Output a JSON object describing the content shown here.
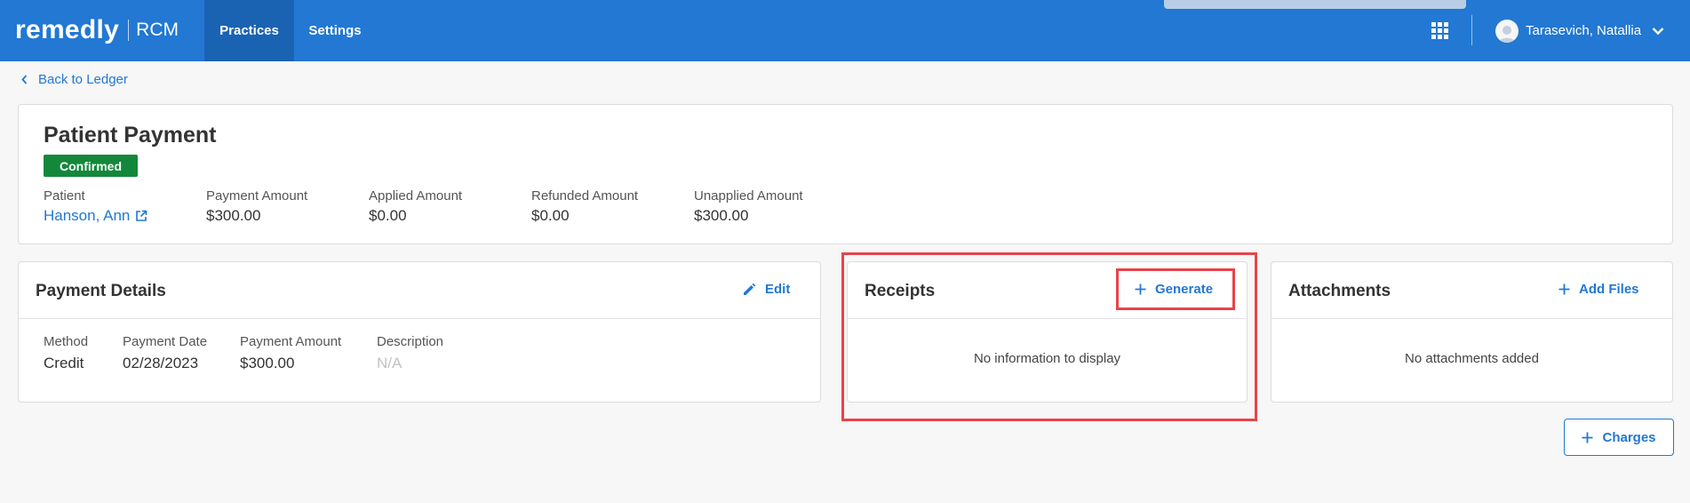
{
  "header": {
    "logo_main": "remedly",
    "logo_sub": "RCM",
    "nav": [
      "Practices",
      "Settings"
    ],
    "active_nav": "Practices",
    "user_name": "Tarasevich, Natallia",
    "primary_color": "#2278d2"
  },
  "back_link": "Back to Ledger",
  "payment": {
    "title": "Patient Payment",
    "status": "Confirmed",
    "status_color": "#13883a",
    "stats": [
      {
        "label": "Patient",
        "value": "Hanson, Ann"
      },
      {
        "label": "Payment Amount",
        "value": "$300.00"
      },
      {
        "label": "Applied Amount",
        "value": "$0.00"
      },
      {
        "label": "Refunded Amount",
        "value": "$0.00"
      },
      {
        "label": "Unapplied Amount",
        "value": "$300.00"
      }
    ]
  },
  "payment_details": {
    "title": "Payment Details",
    "action": "Edit",
    "fields": [
      {
        "label": "Method",
        "value": "Credit"
      },
      {
        "label": "Payment Date",
        "value": "02/28/2023"
      },
      {
        "label": "Payment Amount",
        "value": "$300.00"
      },
      {
        "label": "Description",
        "value": "N/A"
      }
    ]
  },
  "receipts": {
    "title": "Receipts",
    "action": "Generate",
    "empty": "No information to display"
  },
  "attachments": {
    "title": "Attachments",
    "action": "Add Files",
    "empty": "No attachments added"
  },
  "charges_button": "Charges",
  "highlight_color": "#e8434a"
}
